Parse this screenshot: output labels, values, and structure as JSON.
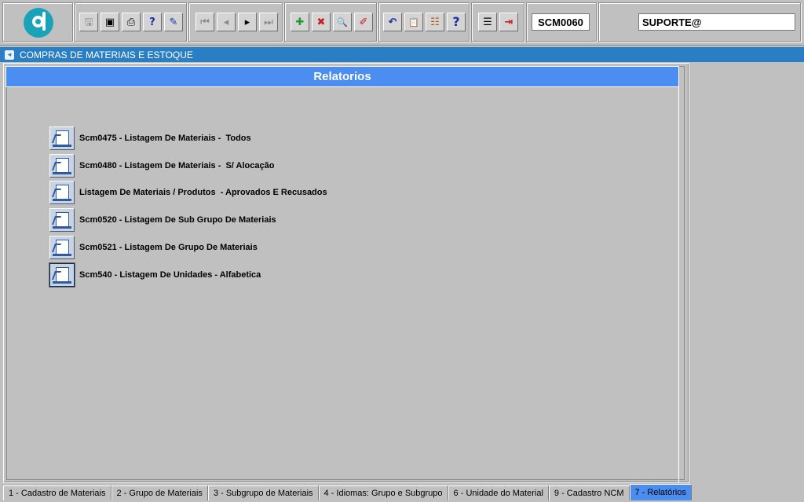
{
  "toolbar": {
    "form_code": "SCM0060",
    "user": "SUPORTE@",
    "buttons": [
      {
        "name": "save-icon",
        "glyph": "🖫"
      },
      {
        "name": "screen-icon",
        "glyph": "▣"
      },
      {
        "name": "print-icon",
        "glyph": "⎙"
      },
      {
        "name": "query-help-icon",
        "glyph": "?"
      },
      {
        "name": "edit-query-icon",
        "glyph": "✎"
      },
      {
        "name": "first-record-icon",
        "glyph": "⏮"
      },
      {
        "name": "prev-record-icon",
        "glyph": "◂"
      },
      {
        "name": "next-record-icon",
        "glyph": "▸"
      },
      {
        "name": "last-record-icon",
        "glyph": "⏭"
      },
      {
        "name": "insert-icon",
        "glyph": "✚"
      },
      {
        "name": "delete-icon",
        "glyph": "✖"
      },
      {
        "name": "search-icon",
        "glyph": "🔍"
      },
      {
        "name": "clear-icon",
        "glyph": "✐"
      },
      {
        "name": "undo-icon",
        "glyph": "↶"
      },
      {
        "name": "clipboard-icon",
        "glyph": "📋"
      },
      {
        "name": "list-icon",
        "glyph": "☷"
      },
      {
        "name": "help-icon",
        "glyph": "?"
      },
      {
        "name": "menu-icon",
        "glyph": "☰"
      },
      {
        "name": "exit-icon",
        "glyph": "⇥"
      }
    ],
    "colors": {
      "insert": "#1a9c2a",
      "delete": "#c81e1e",
      "help": "#1a2ea8",
      "exit": "#c81e1e"
    }
  },
  "module": {
    "title": "COMPRAS DE MATERIAIS E ESTOQUE"
  },
  "panel": {
    "title": "Relatorios"
  },
  "reports": [
    {
      "label": "Scm0475 - Listagem De Materiais -  Todos"
    },
    {
      "label": "Scm0480 - Listagem De Materiais -  S/ Alocação"
    },
    {
      "label": "Listagem De Materiais / Produtos  - Aprovados E Recusados"
    },
    {
      "label": "Scm0520 - Listagem De Sub Grupo De Materiais"
    },
    {
      "label": "Scm0521 - Listagem De Grupo De Materiais"
    },
    {
      "label": "Scm540 - Listagem De Unidades - Alfabetica"
    }
  ],
  "tabs": [
    {
      "label": "1 - Cadastro de Materiais"
    },
    {
      "label": "2 - Grupo de Materiais"
    },
    {
      "label": "3 - Subgrupo de Materiais"
    },
    {
      "label": "4 - Idiomas: Grupo e Subgrupo"
    },
    {
      "label": "6 - Unidade do Material"
    },
    {
      "label": "9 - Cadastro NCM"
    },
    {
      "label": "7 - Relatórios"
    }
  ]
}
